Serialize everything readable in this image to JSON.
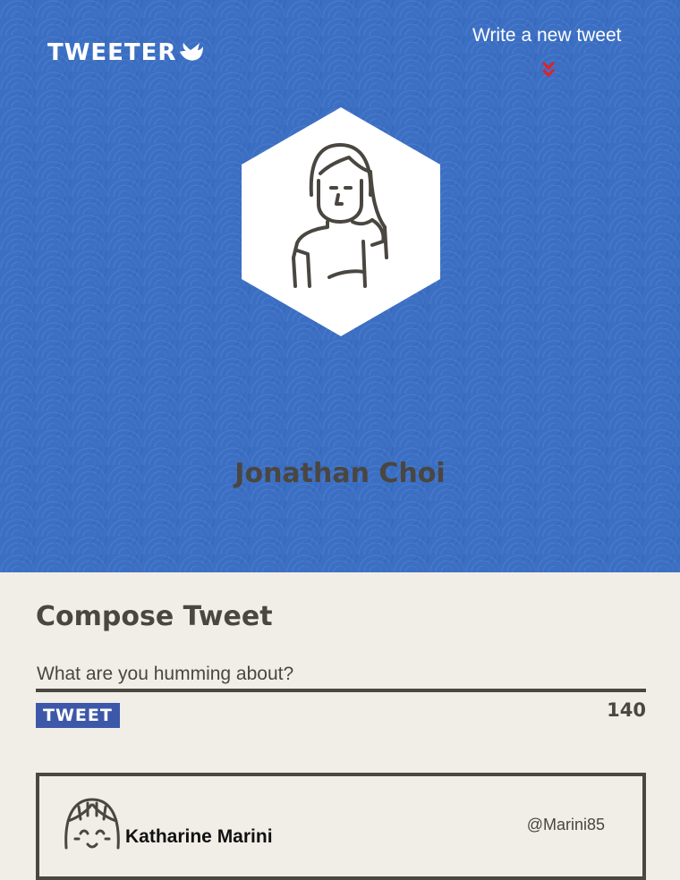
{
  "nav": {
    "logo_text": "TWEETER",
    "write_link": "Write a new tweet",
    "icons": {
      "logo": "bird-icon",
      "arrow": "double-chevron-down-icon"
    }
  },
  "profile": {
    "name": "Jonathan Choi",
    "avatar_icon": "avatar-woman-icon"
  },
  "compose": {
    "title": "Compose Tweet",
    "placeholder": "What are you humming about?",
    "button_label": "TWEET",
    "char_count": "140"
  },
  "tweets": [
    {
      "name": "Katharine Marini",
      "handle": "@Marini85",
      "avatar_icon": "avatar-icon"
    }
  ],
  "colors": {
    "hero_bg": "#3b6fc4",
    "button_bg": "#3d58a8",
    "accent_red": "#e52020",
    "text_dark": "#4a4640",
    "page_bg": "#f1eee8"
  }
}
